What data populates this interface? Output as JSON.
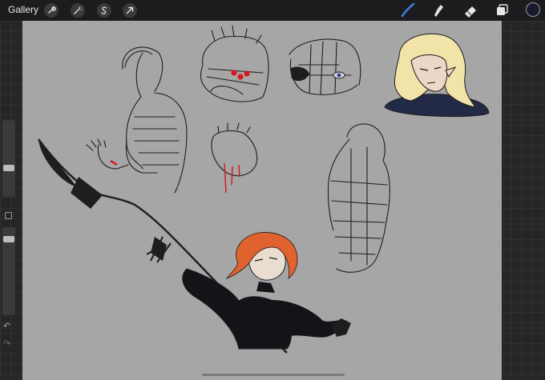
{
  "topbar": {
    "gallery_label": "Gallery",
    "left_actions": [
      {
        "icon": "wrench-icon"
      },
      {
        "icon": "magic-wand-icon"
      },
      {
        "icon": "selection-s-icon"
      },
      {
        "icon": "transform-arrow-icon"
      }
    ],
    "tools": [
      {
        "icon": "brush-icon",
        "active": true,
        "color": "#3b7ddd"
      },
      {
        "icon": "smudge-icon",
        "active": false
      },
      {
        "icon": "eraser-icon",
        "active": false
      },
      {
        "icon": "layers-icon",
        "active": false
      }
    ],
    "current_color": "#1a1a2e"
  },
  "sidebar": {
    "brush_size_level": 0.45,
    "opacity_level": 0.95
  },
  "colors": {
    "canvas": "#a6a6a6",
    "ink": "#1e1e1e",
    "hair_orange": "#e0622e",
    "hair_blonde": "#f2e3a8",
    "navy": "#232a45",
    "blood": "#d9141a"
  }
}
